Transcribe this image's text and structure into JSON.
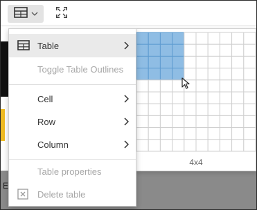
{
  "toolbar": {
    "table_button": {
      "icon": "table-icon",
      "dropdown_icon": "chevron-down-icon"
    },
    "fullscreen_button": {
      "icon": "fullscreen-icon"
    }
  },
  "menu": {
    "items": [
      {
        "label": "Table",
        "icon": "table-icon",
        "has_submenu": true,
        "active": true,
        "disabled": false
      },
      {
        "label": "Toggle Table Outlines",
        "has_submenu": false,
        "active": false,
        "disabled": true
      },
      {
        "label": "Cell",
        "has_submenu": true,
        "active": false,
        "disabled": false
      },
      {
        "label": "Row",
        "has_submenu": true,
        "active": false,
        "disabled": false
      },
      {
        "label": "Column",
        "has_submenu": true,
        "active": false,
        "disabled": false
      },
      {
        "label": "Table properties",
        "has_submenu": false,
        "active": false,
        "disabled": true
      },
      {
        "label": "Delete table",
        "icon": "delete-table-icon",
        "has_submenu": false,
        "active": false,
        "disabled": true
      }
    ]
  },
  "grid_picker": {
    "columns": 10,
    "rows": 10,
    "selected_columns": 4,
    "selected_rows": 4,
    "size_label": "4x4",
    "highlight_color": "#8fbde4",
    "highlight_border": "#5e9bd0"
  },
  "background_letter": "E"
}
